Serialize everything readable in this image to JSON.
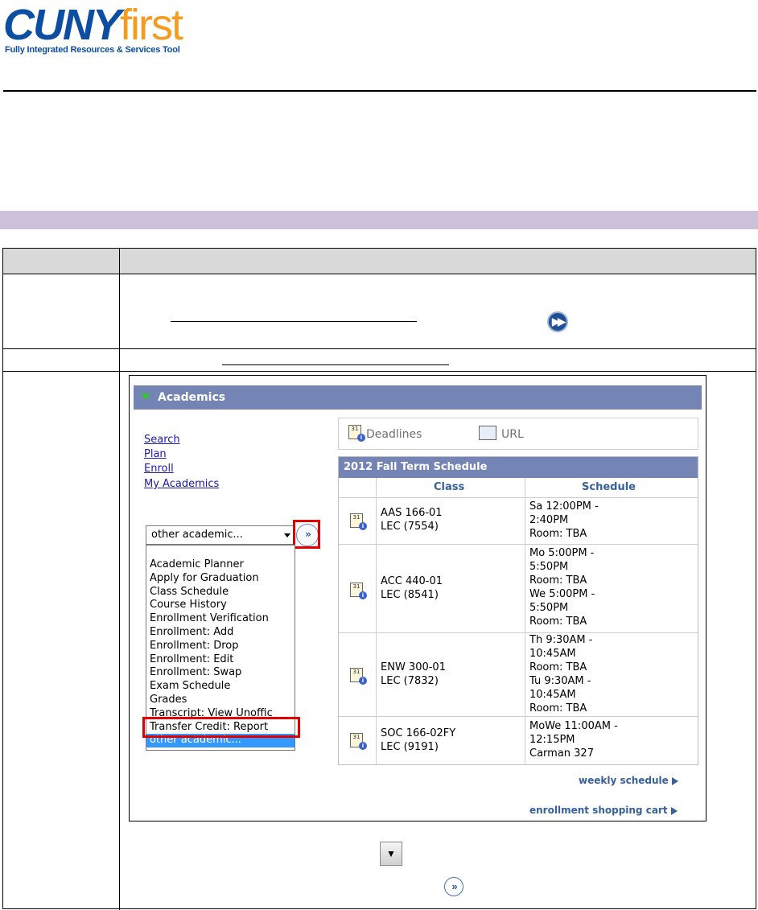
{
  "brand": {
    "cuny": "CUNY",
    "first": "first",
    "tagline": "Fully Integrated Resources & Services Tool"
  },
  "colors": {
    "brand_blue": "#0b4ea2",
    "brand_orange": "#f39c1f",
    "band": "#ccc0da",
    "panel": "#7384b5",
    "highlight": "#e00000"
  },
  "icons": {
    "fast_forward": "fast-forward-icon",
    "dropdown_button": "dropdown-button-icon",
    "go_arrow": "go-arrow-icon"
  },
  "academics": {
    "title": "Academics",
    "links": [
      "Search",
      "Plan",
      "Enroll",
      "My Academics"
    ],
    "select_value": "other academic...",
    "go_symbol": "»",
    "dropdown_options": [
      "Academic Planner",
      "Apply for Graduation",
      "Class Schedule",
      "Course History",
      "Enrollment Verification",
      "Enrollment: Add",
      "Enrollment: Drop",
      "Enrollment: Edit",
      "Enrollment: Swap",
      "Exam Schedule",
      "Grades",
      "Transcript: View Unoffic",
      "Transfer Credit: Report",
      "other academic..."
    ],
    "highlighted_option": "Transfer Credit: Report",
    "toolbar": {
      "deadlines": "Deadlines",
      "url": "URL"
    },
    "schedule": {
      "title": "2012 Fall Term Schedule",
      "headers": [
        "Class",
        "Schedule"
      ],
      "rows": [
        {
          "class": [
            "AAS 166-01",
            "LEC (7554)"
          ],
          "schedule": [
            "Sa 12:00PM -",
            "2:40PM",
            "Room:  TBA"
          ]
        },
        {
          "class": [
            "ACC 440-01",
            "LEC (8541)"
          ],
          "schedule": [
            "Mo 5:00PM -",
            "5:50PM",
            "Room:  TBA",
            "We 5:00PM -",
            "5:50PM",
            "Room:  TBA"
          ]
        },
        {
          "class": [
            "ENW 300-01",
            "LEC (7832)"
          ],
          "schedule": [
            "Th 9:30AM -",
            "10:45AM",
            "Room:  TBA",
            "Tu 9:30AM -",
            "10:45AM",
            "Room:  TBA"
          ]
        },
        {
          "class": [
            "SOC 166-02FY",
            "LEC (9191)"
          ],
          "schedule": [
            "MoWe 11:00AM -",
            "12:15PM",
            "Carman 327"
          ]
        }
      ]
    },
    "weekly_schedule": "weekly schedule",
    "shopping_cart": "enrollment shopping cart"
  }
}
